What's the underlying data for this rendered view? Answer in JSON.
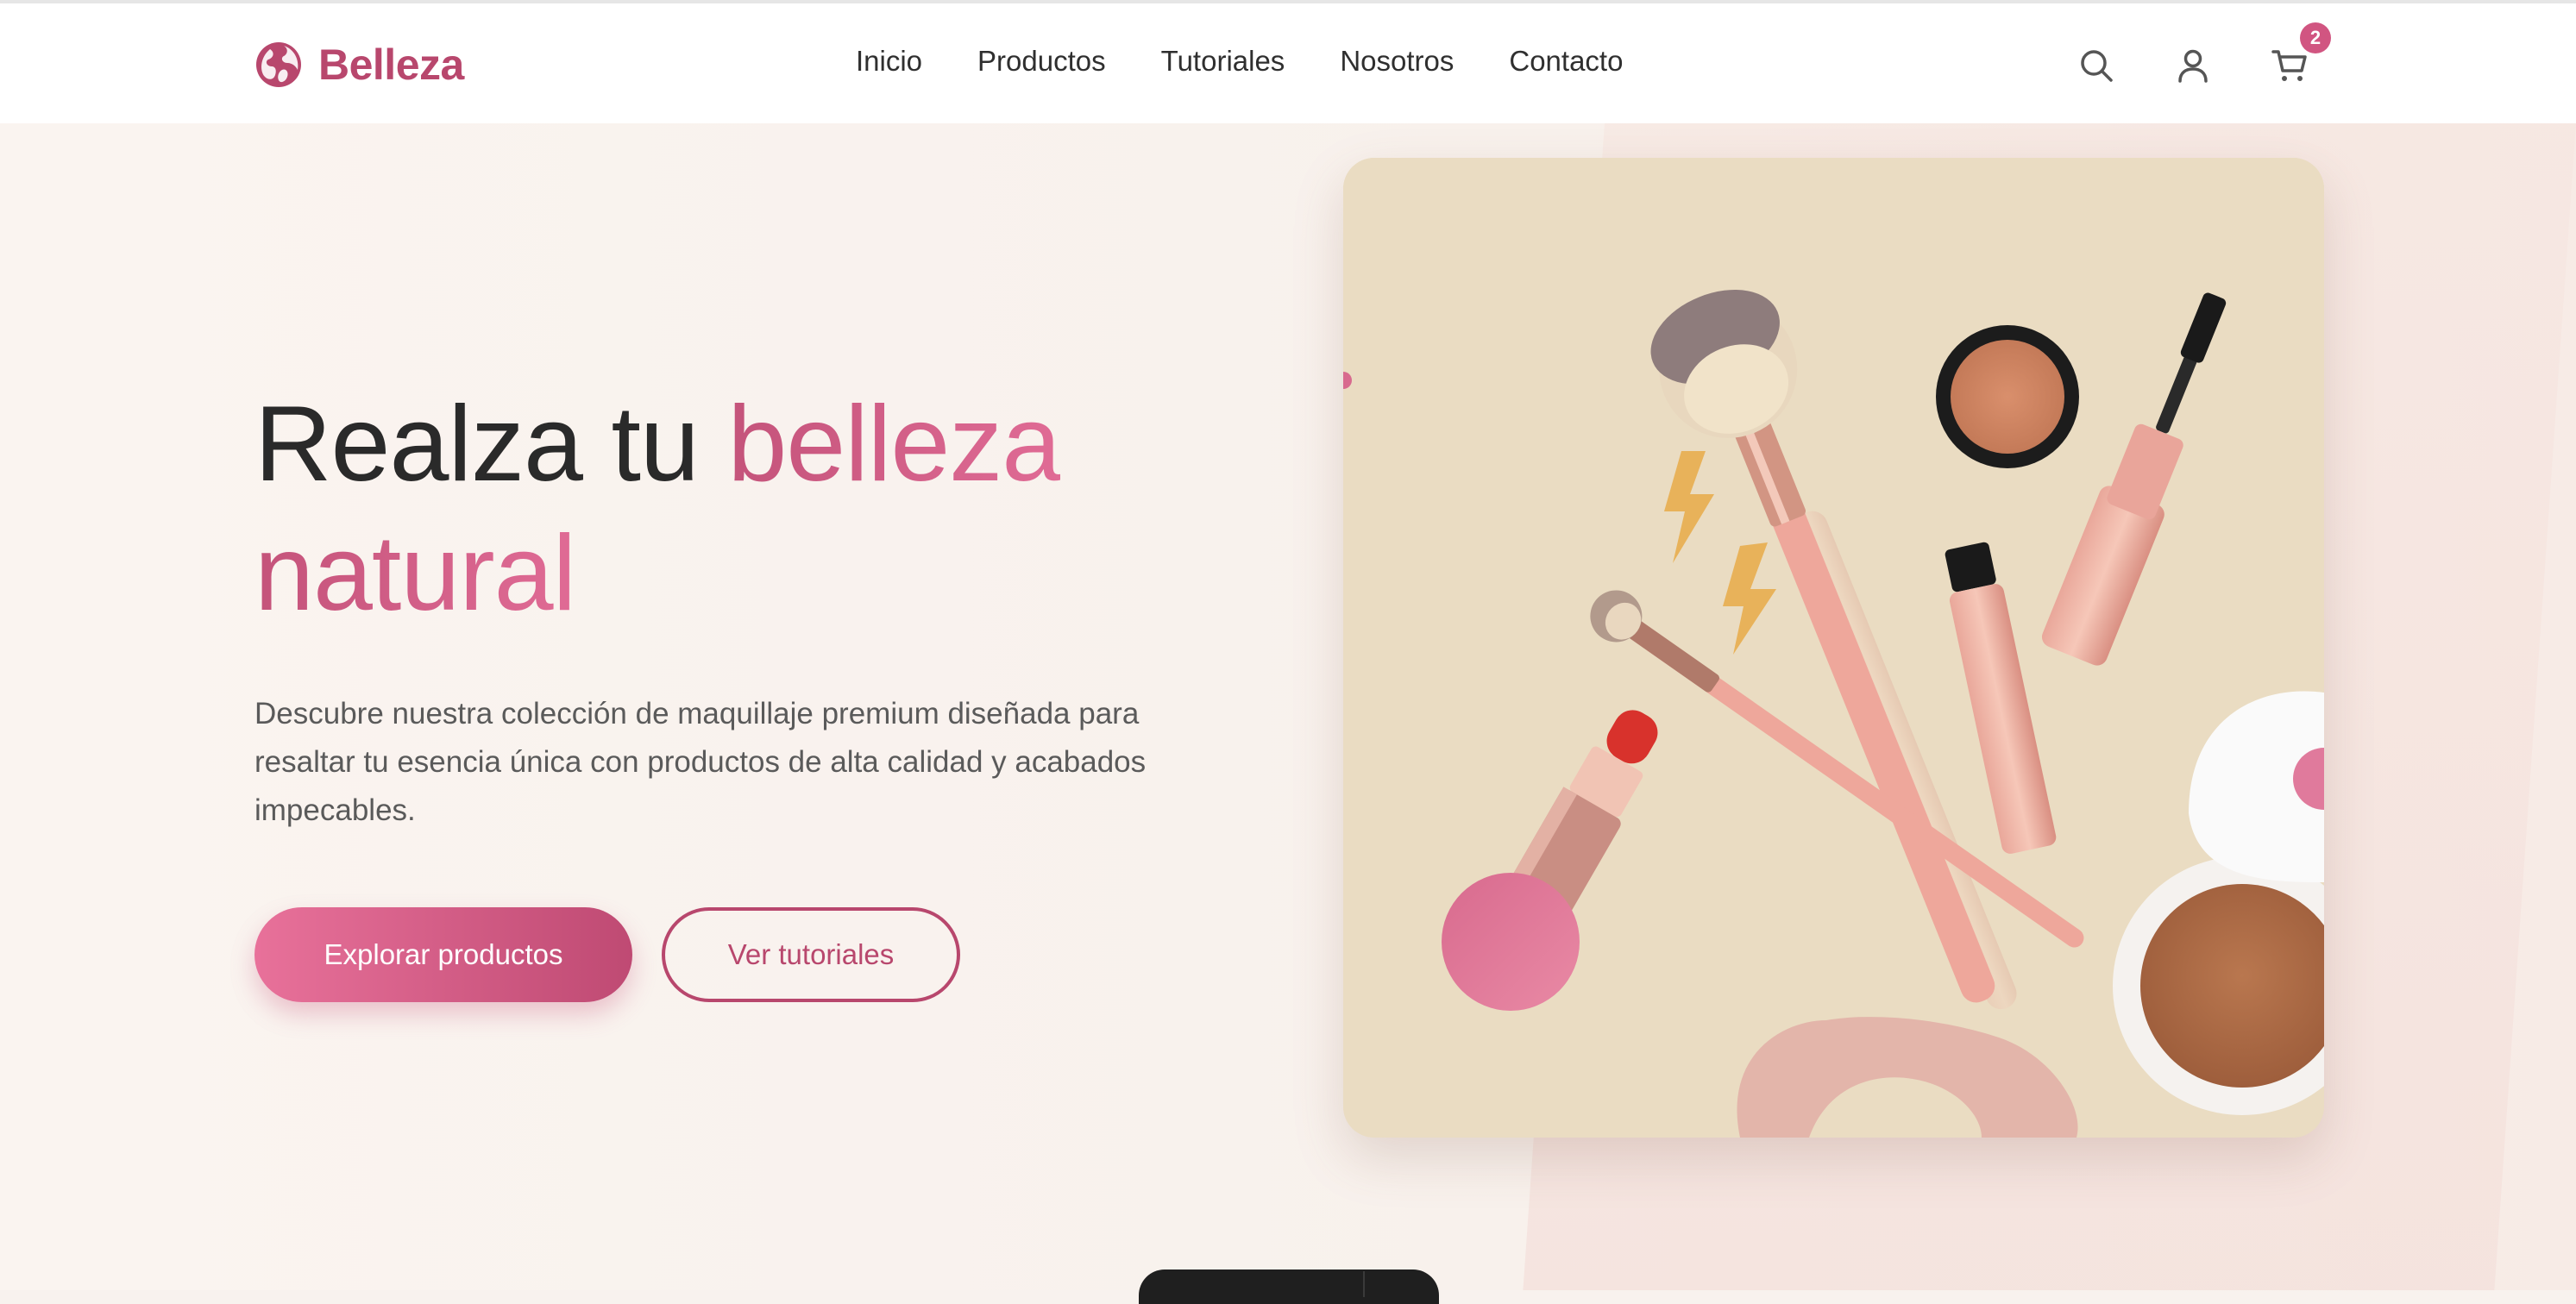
{
  "brand": {
    "name": "Belleza",
    "logo_icon": "globe-icon",
    "color": "#b8476d"
  },
  "nav": {
    "items": [
      {
        "label": "Inicio"
      },
      {
        "label": "Productos"
      },
      {
        "label": "Tutoriales"
      },
      {
        "label": "Nosotros"
      },
      {
        "label": "Contacto"
      }
    ]
  },
  "header_icons": {
    "search": "search-icon",
    "account": "user-icon",
    "cart": "cart-icon",
    "cart_count": "2"
  },
  "hero": {
    "title_plain": "Realza tu",
    "title_accent_1": "belleza",
    "title_accent_2": "natural",
    "description": "Descubre nuestra colección de maquillaje premium diseñada para resaltar tu esencia única con productos de alta calidad y acabados impecables.",
    "primary_button": "Explorar productos",
    "secondary_button": "Ver tutoriales"
  },
  "colors": {
    "accent": "#d15581",
    "accent_dark": "#b8476d",
    "text": "#2a2a2a",
    "background": "#f8f2ee"
  }
}
